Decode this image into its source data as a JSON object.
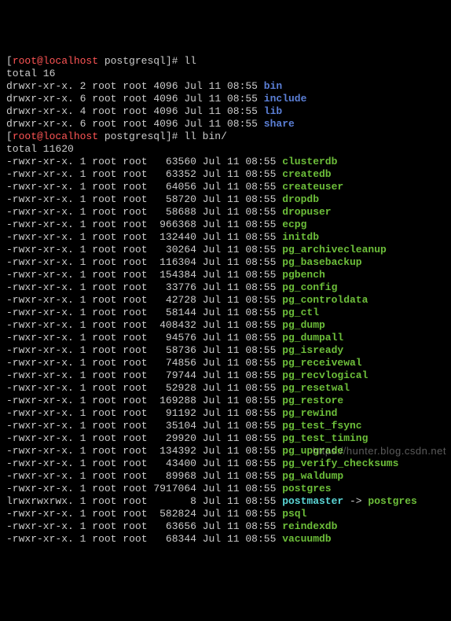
{
  "prompt1": {
    "user": "root",
    "host": "localhost",
    "cwd": "postgresql",
    "cmd": "ll"
  },
  "total1": "total 16",
  "dirlist": [
    {
      "perms": "drwxr-xr-x.",
      "links": "2",
      "owner": "root",
      "group": "root",
      "size": "4096",
      "date": "Jul 11 08:55",
      "name": "bin",
      "cls": "dir"
    },
    {
      "perms": "drwxr-xr-x.",
      "links": "6",
      "owner": "root",
      "group": "root",
      "size": "4096",
      "date": "Jul 11 08:55",
      "name": "include",
      "cls": "dir"
    },
    {
      "perms": "drwxr-xr-x.",
      "links": "4",
      "owner": "root",
      "group": "root",
      "size": "4096",
      "date": "Jul 11 08:55",
      "name": "lib",
      "cls": "dir"
    },
    {
      "perms": "drwxr-xr-x.",
      "links": "6",
      "owner": "root",
      "group": "root",
      "size": "4096",
      "date": "Jul 11 08:55",
      "name": "share",
      "cls": "dir"
    }
  ],
  "prompt2": {
    "user": "root",
    "host": "localhost",
    "cwd": "postgresql",
    "cmd": "ll bin/"
  },
  "total2": "total 11620",
  "binlist": [
    {
      "perms": "-rwxr-xr-x.",
      "links": "1",
      "owner": "root",
      "group": "root",
      "size": "63560",
      "date": "Jul 11 08:55",
      "name": "clusterdb",
      "cls": "exec"
    },
    {
      "perms": "-rwxr-xr-x.",
      "links": "1",
      "owner": "root",
      "group": "root",
      "size": "63352",
      "date": "Jul 11 08:55",
      "name": "createdb",
      "cls": "exec"
    },
    {
      "perms": "-rwxr-xr-x.",
      "links": "1",
      "owner": "root",
      "group": "root",
      "size": "64056",
      "date": "Jul 11 08:55",
      "name": "createuser",
      "cls": "exec"
    },
    {
      "perms": "-rwxr-xr-x.",
      "links": "1",
      "owner": "root",
      "group": "root",
      "size": "58720",
      "date": "Jul 11 08:55",
      "name": "dropdb",
      "cls": "exec"
    },
    {
      "perms": "-rwxr-xr-x.",
      "links": "1",
      "owner": "root",
      "group": "root",
      "size": "58688",
      "date": "Jul 11 08:55",
      "name": "dropuser",
      "cls": "exec"
    },
    {
      "perms": "-rwxr-xr-x.",
      "links": "1",
      "owner": "root",
      "group": "root",
      "size": "966368",
      "date": "Jul 11 08:55",
      "name": "ecpg",
      "cls": "exec"
    },
    {
      "perms": "-rwxr-xr-x.",
      "links": "1",
      "owner": "root",
      "group": "root",
      "size": "132440",
      "date": "Jul 11 08:55",
      "name": "initdb",
      "cls": "exec"
    },
    {
      "perms": "-rwxr-xr-x.",
      "links": "1",
      "owner": "root",
      "group": "root",
      "size": "30264",
      "date": "Jul 11 08:55",
      "name": "pg_archivecleanup",
      "cls": "exec"
    },
    {
      "perms": "-rwxr-xr-x.",
      "links": "1",
      "owner": "root",
      "group": "root",
      "size": "116304",
      "date": "Jul 11 08:55",
      "name": "pg_basebackup",
      "cls": "exec"
    },
    {
      "perms": "-rwxr-xr-x.",
      "links": "1",
      "owner": "root",
      "group": "root",
      "size": "154384",
      "date": "Jul 11 08:55",
      "name": "pgbench",
      "cls": "exec"
    },
    {
      "perms": "-rwxr-xr-x.",
      "links": "1",
      "owner": "root",
      "group": "root",
      "size": "33776",
      "date": "Jul 11 08:55",
      "name": "pg_config",
      "cls": "exec"
    },
    {
      "perms": "-rwxr-xr-x.",
      "links": "1",
      "owner": "root",
      "group": "root",
      "size": "42728",
      "date": "Jul 11 08:55",
      "name": "pg_controldata",
      "cls": "exec"
    },
    {
      "perms": "-rwxr-xr-x.",
      "links": "1",
      "owner": "root",
      "group": "root",
      "size": "58144",
      "date": "Jul 11 08:55",
      "name": "pg_ctl",
      "cls": "exec"
    },
    {
      "perms": "-rwxr-xr-x.",
      "links": "1",
      "owner": "root",
      "group": "root",
      "size": "408432",
      "date": "Jul 11 08:55",
      "name": "pg_dump",
      "cls": "exec"
    },
    {
      "perms": "-rwxr-xr-x.",
      "links": "1",
      "owner": "root",
      "group": "root",
      "size": "94576",
      "date": "Jul 11 08:55",
      "name": "pg_dumpall",
      "cls": "exec"
    },
    {
      "perms": "-rwxr-xr-x.",
      "links": "1",
      "owner": "root",
      "group": "root",
      "size": "58736",
      "date": "Jul 11 08:55",
      "name": "pg_isready",
      "cls": "exec"
    },
    {
      "perms": "-rwxr-xr-x.",
      "links": "1",
      "owner": "root",
      "group": "root",
      "size": "74856",
      "date": "Jul 11 08:55",
      "name": "pg_receivewal",
      "cls": "exec"
    },
    {
      "perms": "-rwxr-xr-x.",
      "links": "1",
      "owner": "root",
      "group": "root",
      "size": "79744",
      "date": "Jul 11 08:55",
      "name": "pg_recvlogical",
      "cls": "exec"
    },
    {
      "perms": "-rwxr-xr-x.",
      "links": "1",
      "owner": "root",
      "group": "root",
      "size": "52928",
      "date": "Jul 11 08:55",
      "name": "pg_resetwal",
      "cls": "exec"
    },
    {
      "perms": "-rwxr-xr-x.",
      "links": "1",
      "owner": "root",
      "group": "root",
      "size": "169288",
      "date": "Jul 11 08:55",
      "name": "pg_restore",
      "cls": "exec"
    },
    {
      "perms": "-rwxr-xr-x.",
      "links": "1",
      "owner": "root",
      "group": "root",
      "size": "91192",
      "date": "Jul 11 08:55",
      "name": "pg_rewind",
      "cls": "exec"
    },
    {
      "perms": "-rwxr-xr-x.",
      "links": "1",
      "owner": "root",
      "group": "root",
      "size": "35104",
      "date": "Jul 11 08:55",
      "name": "pg_test_fsync",
      "cls": "exec"
    },
    {
      "perms": "-rwxr-xr-x.",
      "links": "1",
      "owner": "root",
      "group": "root",
      "size": "29920",
      "date": "Jul 11 08:55",
      "name": "pg_test_timing",
      "cls": "exec"
    },
    {
      "perms": "-rwxr-xr-x.",
      "links": "1",
      "owner": "root",
      "group": "root",
      "size": "134392",
      "date": "Jul 11 08:55",
      "name": "pg_upgrade",
      "cls": "exec"
    },
    {
      "perms": "-rwxr-xr-x.",
      "links": "1",
      "owner": "root",
      "group": "root",
      "size": "43400",
      "date": "Jul 11 08:55",
      "name": "pg_verify_checksums",
      "cls": "exec"
    },
    {
      "perms": "-rwxr-xr-x.",
      "links": "1",
      "owner": "root",
      "group": "root",
      "size": "89968",
      "date": "Jul 11 08:55",
      "name": "pg_waldump",
      "cls": "exec"
    },
    {
      "perms": "-rwxr-xr-x.",
      "links": "1",
      "owner": "root",
      "group": "root",
      "size": "7917064",
      "date": "Jul 11 08:55",
      "name": "postgres",
      "cls": "exec"
    },
    {
      "perms": "lrwxrwxrwx.",
      "links": "1",
      "owner": "root",
      "group": "root",
      "size": "8",
      "date": "Jul 11 08:55",
      "name": "postmaster",
      "cls": "link",
      "target": "postgres"
    },
    {
      "perms": "-rwxr-xr-x.",
      "links": "1",
      "owner": "root",
      "group": "root",
      "size": "582824",
      "date": "Jul 11 08:55",
      "name": "psql",
      "cls": "exec"
    },
    {
      "perms": "-rwxr-xr-x.",
      "links": "1",
      "owner": "root",
      "group": "root",
      "size": "63656",
      "date": "Jul 11 08:55",
      "name": "reindexdb",
      "cls": "exec"
    },
    {
      "perms": "-rwxr-xr-x.",
      "links": "1",
      "owner": "root",
      "group": "root",
      "size": "68344",
      "date": "Jul 11 08:55",
      "name": "vacuumdb",
      "cls": "exec"
    }
  ],
  "watermark": "https://hunter.blog.csdn.net"
}
